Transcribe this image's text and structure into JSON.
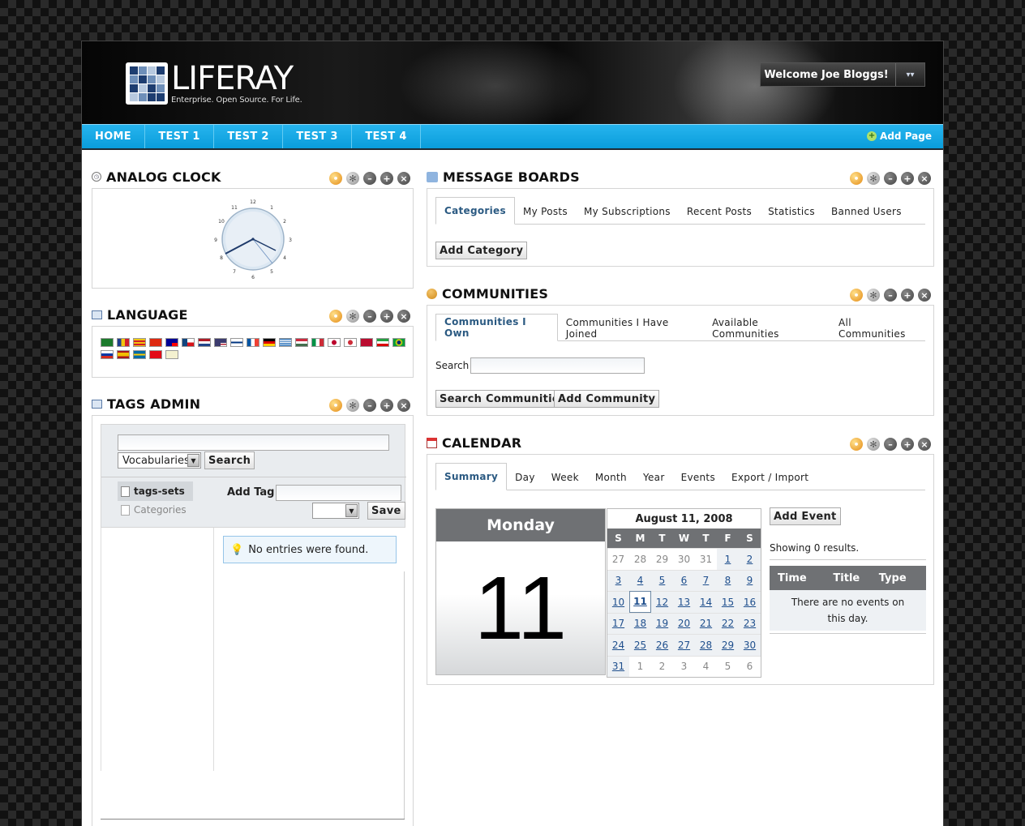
{
  "header": {
    "logo_name": "LIFERAY",
    "logo_tagline": "Enterprise. Open Source. For Life.",
    "welcome": "Welcome Joe Bloggs!",
    "menu_arrow": "▾▾"
  },
  "nav": {
    "items": [
      "HOME",
      "TEST 1",
      "TEST 2",
      "TEST 3",
      "TEST 4"
    ],
    "add_page": "Add Page"
  },
  "clock": {
    "title": "ANALOG CLOCK",
    "numbers": [
      "12",
      "1",
      "2",
      "3",
      "4",
      "5",
      "6",
      "7",
      "8",
      "9",
      "10",
      "11"
    ]
  },
  "language": {
    "title": "LANGUAGE"
  },
  "tags_admin": {
    "title": "TAGS ADMIN",
    "search_input_value": "",
    "vocab_select": "Vocabularies",
    "search_button": "Search",
    "tags_sets": "tags-sets",
    "categories": "Categories",
    "add_tag_label": "Add Tag",
    "save_button": "Save",
    "no_entries": "No entries were found."
  },
  "message_boards": {
    "title": "MESSAGE BOARDS",
    "tabs": [
      "Categories",
      "My Posts",
      "My Subscriptions",
      "Recent Posts",
      "Statistics",
      "Banned Users"
    ],
    "add_category": "Add Category"
  },
  "communities": {
    "title": "COMMUNITIES",
    "tabs": [
      "Communities I Own",
      "Communities I Have Joined",
      "Available Communities",
      "All Communities"
    ],
    "search_label": "Search",
    "search_button": "Search Communities",
    "add_button": "Add Community"
  },
  "calendar": {
    "title": "CALENDAR",
    "tabs": [
      "Summary",
      "Day",
      "Week",
      "Month",
      "Year",
      "Events",
      "Export / Import"
    ],
    "day_name": "Monday",
    "day_number": "11",
    "month_title": "August 11, 2008",
    "dow": [
      "S",
      "M",
      "T",
      "W",
      "T",
      "F",
      "S"
    ],
    "add_event": "Add Event",
    "showing": "Showing 0 results.",
    "columns": [
      "Time",
      "Title",
      "Type"
    ],
    "no_events": "There are no events on this day."
  },
  "colors": {
    "nav_blue": "#0fa4e0",
    "calendar_header": "#6f7174",
    "tab_active_text": "#2b5a82"
  },
  "icons": {
    "portlet_controls": [
      "look-and-feel-icon",
      "configuration-icon",
      "minimize-icon",
      "maximize-icon",
      "close-icon"
    ]
  }
}
